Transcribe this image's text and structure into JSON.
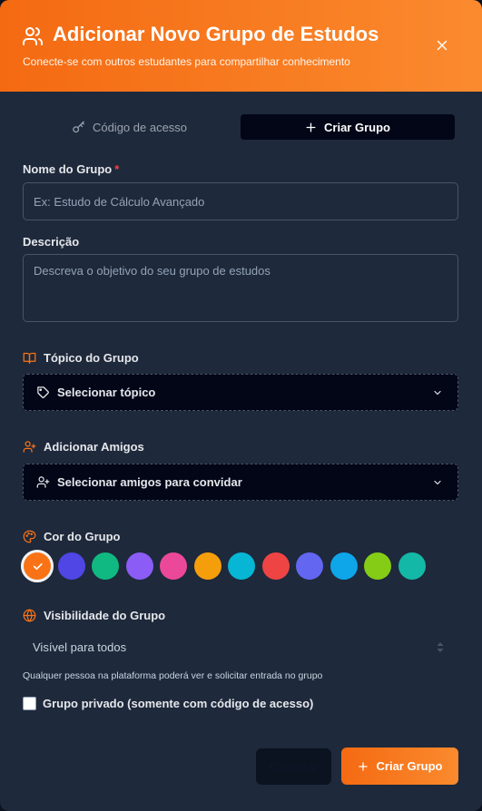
{
  "header": {
    "title": "Adicionar Novo Grupo de Estudos",
    "subtitle": "Conecte-se com outros estudantes para compartilhar conhecimento"
  },
  "tabs": [
    {
      "label": "Código de acesso",
      "icon": "key-icon",
      "active": false
    },
    {
      "label": "Criar Grupo",
      "icon": "plus-icon",
      "active": true
    }
  ],
  "form": {
    "name": {
      "label": "Nome do Grupo",
      "required_mark": "*",
      "value": "",
      "placeholder": "Ex: Estudo de Cálculo Avançado"
    },
    "description": {
      "label": "Descrição",
      "value": "",
      "placeholder": "Descreva o objetivo do seu grupo de estudos"
    },
    "topic": {
      "label": "Tópico do Grupo",
      "icon": "book-open-icon",
      "value": "Selecionar tópico",
      "value_icon": "tag-icon"
    },
    "friends": {
      "label": "Adicionar Amigos",
      "icon": "user-plus-icon",
      "value": "Selecionar amigos para convidar",
      "value_icon": "user-plus-icon"
    },
    "color": {
      "label": "Cor do Grupo",
      "icon": "palette-icon",
      "selected_index": 0,
      "options": [
        "#f97316",
        "#4f46e5",
        "#10b981",
        "#8b5cf6",
        "#ec4899",
        "#f59e0b",
        "#06b6d4",
        "#ef4444",
        "#6366f1",
        "#0ea5e9",
        "#84cc16",
        "#14b8a6"
      ]
    },
    "visibility": {
      "label": "Visibilidade do Grupo",
      "icon": "globe-icon",
      "value": "Visível para todos",
      "hint": "Qualquer pessoa na plataforma poderá ver e solicitar entrada no grupo"
    },
    "private": {
      "label": "Grupo privado (somente com código de acesso)",
      "checked": false
    }
  },
  "actions": {
    "cancel": "Cancelar",
    "create": "Criar Grupo"
  },
  "colors": {
    "accent": "#f97316",
    "background": "#1e293b",
    "required": "#ef4444"
  }
}
